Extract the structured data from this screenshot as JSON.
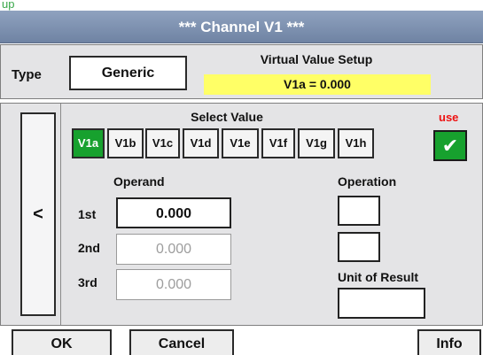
{
  "caption": "up",
  "window": {
    "title": "***   Channel V1   ***"
  },
  "type": {
    "label": "Type",
    "value": "Generic"
  },
  "virtual_setup": {
    "label": "Virtual Value Setup",
    "expression": "V1a = 0.000"
  },
  "back_label": "<",
  "select_value": {
    "label": "Select Value",
    "tabs": [
      {
        "label": "V1a",
        "active": true
      },
      {
        "label": "V1b",
        "active": false
      },
      {
        "label": "V1c",
        "active": false
      },
      {
        "label": "V1d",
        "active": false
      },
      {
        "label": "V1e",
        "active": false
      },
      {
        "label": "V1f",
        "active": false
      },
      {
        "label": "V1g",
        "active": false
      },
      {
        "label": "V1h",
        "active": false
      }
    ]
  },
  "use": {
    "label": "use",
    "checked": true,
    "check_glyph": "✔"
  },
  "operand": {
    "header": "Operand",
    "rows": [
      {
        "label": "1st",
        "value": "0.000",
        "enabled": true
      },
      {
        "label": "2nd",
        "value": "0.000",
        "enabled": false
      },
      {
        "label": "3rd",
        "value": "0.000",
        "enabled": false
      }
    ]
  },
  "operation": {
    "header": "Operation",
    "values": [
      "",
      ""
    ]
  },
  "unit_of_result": {
    "label": "Unit of Result",
    "value": ""
  },
  "buttons": {
    "ok": "OK",
    "cancel": "Cancel",
    "info": "Info"
  },
  "colors": {
    "active_green": "#17a12e",
    "highlight_yellow": "#ffff66",
    "title_blue": "#7f92b1",
    "use_red": "#ee1111"
  }
}
